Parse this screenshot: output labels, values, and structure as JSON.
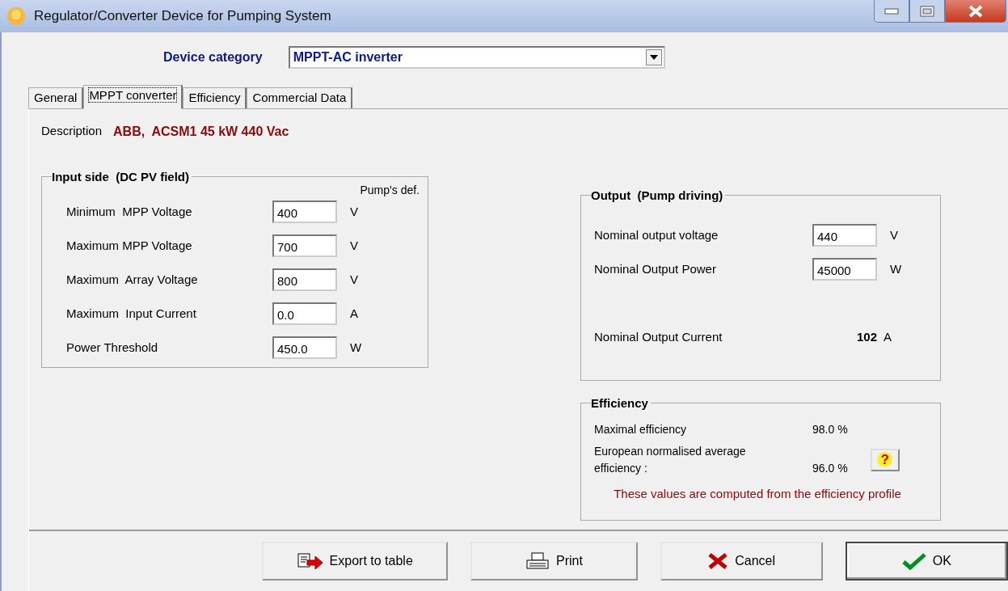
{
  "window": {
    "title": "Regulator/Converter Device for Pumping System"
  },
  "device_category": {
    "label": "Device category",
    "value": "MPPT-AC inverter"
  },
  "tabs": [
    {
      "label": "General",
      "selected": false
    },
    {
      "label": "MPPT converter",
      "selected": true
    },
    {
      "label": "Efficiency",
      "selected": false
    },
    {
      "label": "Commercial Data",
      "selected": false
    }
  ],
  "description": {
    "label": "Description",
    "value": "ABB,  ACSM1 45 kW 440 Vac"
  },
  "input_side": {
    "title": "Input side  (DC PV field)",
    "column_header": "Pump's def.",
    "rows": [
      {
        "label": "Minimum  MPP Voltage",
        "value": "400",
        "unit": "V"
      },
      {
        "label": "Maximum MPP Voltage",
        "value": "700",
        "unit": "V"
      },
      {
        "label": "Maximum  Array Voltage",
        "value": "800",
        "unit": "V"
      },
      {
        "label": "Maximum  Input Current",
        "value": "0.0",
        "unit": "A"
      },
      {
        "label": "Power Threshold",
        "value": "450.0",
        "unit": "W"
      }
    ]
  },
  "output": {
    "title": "Output  (Pump driving)",
    "rows": [
      {
        "kind": "field",
        "label": "Nominal output voltage",
        "value": "440",
        "unit": "V"
      },
      {
        "kind": "field",
        "label": "Nominal Output Power",
        "value": "45000",
        "unit": "W"
      },
      {
        "kind": "reading",
        "label": "Nominal Output Current",
        "value": "102",
        "unit": "A"
      }
    ]
  },
  "efficiency": {
    "title": "Efficiency",
    "rows": [
      {
        "label": "Maximal efficiency",
        "value": "98.0 %"
      },
      {
        "label": "European normalised average efficiency :",
        "value": "96.0 %"
      }
    ],
    "help_button": "?",
    "note": "These values are computed from the efficiency profile"
  },
  "buttons": [
    {
      "label": "Export to table",
      "kind": "export",
      "default": false
    },
    {
      "label": "Print",
      "kind": "print",
      "default": false
    },
    {
      "label": "Cancel",
      "kind": "cancel",
      "default": false
    },
    {
      "label": "OK",
      "kind": "ok",
      "default": true
    }
  ]
}
